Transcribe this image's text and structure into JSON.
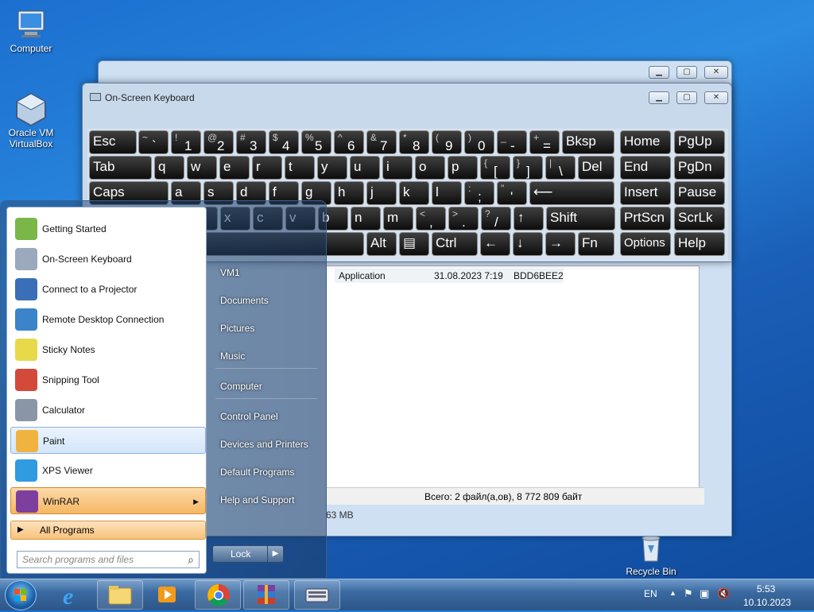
{
  "desktop": {
    "icons": [
      {
        "label": "Computer"
      },
      {
        "label": "Oracle VM VirtualBox"
      },
      {
        "label": "Recycle Bin"
      }
    ]
  },
  "background_window": {
    "row": {
      "type": "Application",
      "date": "31.08.2023 7:19",
      "name": "BDD6BEE2"
    },
    "status": "Всего: 2 файл(а,ов), 8 772 809 байт",
    "status2": "63 MB"
  },
  "osk": {
    "title": "On-Screen Keyboard",
    "rows": [
      [
        {
          "l": "Esc"
        },
        {
          "t": "~",
          "b": "`"
        },
        {
          "t": "!",
          "b": "1"
        },
        {
          "t": "@",
          "b": "2"
        },
        {
          "t": "#",
          "b": "3"
        },
        {
          "t": "$",
          "b": "4"
        },
        {
          "t": "%",
          "b": "5"
        },
        {
          "t": "^",
          "b": "6"
        },
        {
          "t": "&",
          "b": "7"
        },
        {
          "t": "*",
          "b": "8"
        },
        {
          "t": "(",
          "b": "9"
        },
        {
          "t": ")",
          "b": "0"
        },
        {
          "t": "_",
          "b": "-"
        },
        {
          "t": "+",
          "b": "="
        },
        {
          "l": "Bksp"
        },
        {
          "l": "Home"
        },
        {
          "l": "PgUp"
        }
      ],
      [
        {
          "l": "Tab"
        },
        {
          "l": "q"
        },
        {
          "l": "w"
        },
        {
          "l": "e"
        },
        {
          "l": "r"
        },
        {
          "l": "t"
        },
        {
          "l": "y"
        },
        {
          "l": "u"
        },
        {
          "l": "i"
        },
        {
          "l": "o"
        },
        {
          "l": "p"
        },
        {
          "t": "{",
          "b": "["
        },
        {
          "t": "}",
          "b": "]"
        },
        {
          "t": "|",
          "b": "\\"
        },
        {
          "l": "Del"
        },
        {
          "l": "End"
        },
        {
          "l": "PgDn"
        }
      ],
      [
        {
          "l": "Caps"
        },
        {
          "l": "a"
        },
        {
          "l": "s"
        },
        {
          "l": "d"
        },
        {
          "l": "f"
        },
        {
          "l": "g"
        },
        {
          "l": "h"
        },
        {
          "l": "j"
        },
        {
          "l": "k"
        },
        {
          "l": "l"
        },
        {
          "t": ":",
          "b": ";"
        },
        {
          "t": "\"",
          "b": "'"
        },
        {
          "l": "⟵"
        },
        {
          "l": "Insert"
        },
        {
          "l": "Pause"
        }
      ],
      [
        {
          "l": "Shift"
        },
        {
          "l": "z"
        },
        {
          "l": "x"
        },
        {
          "l": "c"
        },
        {
          "l": "v"
        },
        {
          "l": "b"
        },
        {
          "l": "n"
        },
        {
          "l": "m"
        },
        {
          "t": "<",
          "b": ","
        },
        {
          "t": ">",
          "b": "."
        },
        {
          "t": "?",
          "b": "/"
        },
        {
          "l": "↑"
        },
        {
          "l": "Shift"
        },
        {
          "l": "PrtScn"
        },
        {
          "l": "ScrLk"
        }
      ],
      [
        {
          "l": "Ctrl"
        },
        {
          "l": "⊞"
        },
        {
          "l": "Alt"
        },
        {
          "l": ""
        },
        {
          "l": "Alt"
        },
        {
          "l": "▤"
        },
        {
          "l": "Ctrl"
        },
        {
          "l": "←"
        },
        {
          "l": "↓"
        },
        {
          "l": "→"
        },
        {
          "l": "Fn"
        },
        {
          "l": "Options"
        },
        {
          "l": "Help"
        }
      ]
    ]
  },
  "start_menu": {
    "left_items": [
      {
        "label": "Getting Started"
      },
      {
        "label": "On-Screen Keyboard"
      },
      {
        "label": "Connect to a Projector"
      },
      {
        "label": "Remote Desktop Connection"
      },
      {
        "label": "Sticky Notes"
      },
      {
        "label": "Snipping Tool"
      },
      {
        "label": "Calculator"
      },
      {
        "label": "Paint"
      },
      {
        "label": "XPS Viewer"
      },
      {
        "label": "WinRAR"
      }
    ],
    "all_programs": "All Programs",
    "search_placeholder": "Search programs and files",
    "right_items": [
      {
        "label": "VM1"
      },
      {
        "label": "Documents"
      },
      {
        "label": "Pictures"
      },
      {
        "label": "Music"
      },
      {
        "label": "Computer"
      },
      {
        "label": "Control Panel"
      },
      {
        "label": "Devices and Printers"
      },
      {
        "label": "Default Programs"
      },
      {
        "label": "Help and Support"
      }
    ],
    "lock_label": "Lock"
  },
  "taskbar": {
    "language": "EN",
    "time": "5:53",
    "date": "10.10.2023"
  }
}
